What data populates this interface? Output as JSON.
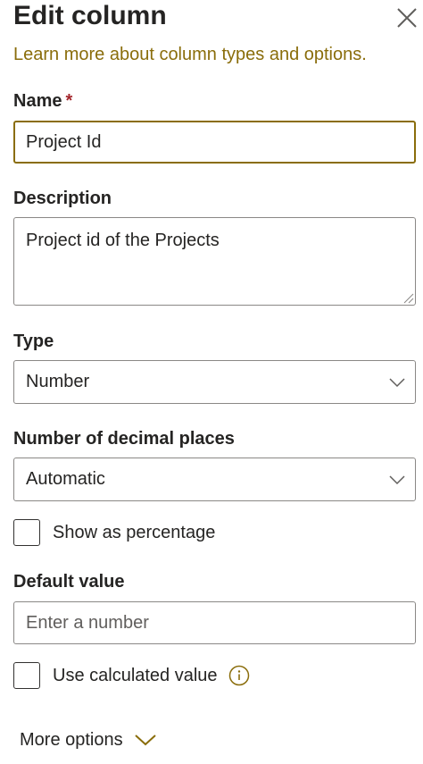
{
  "panel": {
    "title": "Edit column",
    "learn_more": "Learn more about column types and options."
  },
  "name_field": {
    "label": "Name",
    "required_mark": "*",
    "value": "Project Id"
  },
  "description_field": {
    "label": "Description",
    "value": "Project id of the Projects"
  },
  "type_field": {
    "label": "Type",
    "selected": "Number"
  },
  "decimal_field": {
    "label": "Number of decimal places",
    "selected": "Automatic"
  },
  "show_percentage": {
    "label": "Show as percentage",
    "checked": false
  },
  "default_value_field": {
    "label": "Default value",
    "placeholder": "Enter a number"
  },
  "use_calculated": {
    "label": "Use calculated value",
    "checked": false
  },
  "more_options": {
    "label": "More options"
  },
  "icons": {
    "close": "close-icon",
    "chevron_down": "chevron-down-icon",
    "info": "info-icon"
  },
  "colors": {
    "accent": "#8a6d0b",
    "required": "#a4262c",
    "border": "#8a8886",
    "text": "#252423"
  }
}
